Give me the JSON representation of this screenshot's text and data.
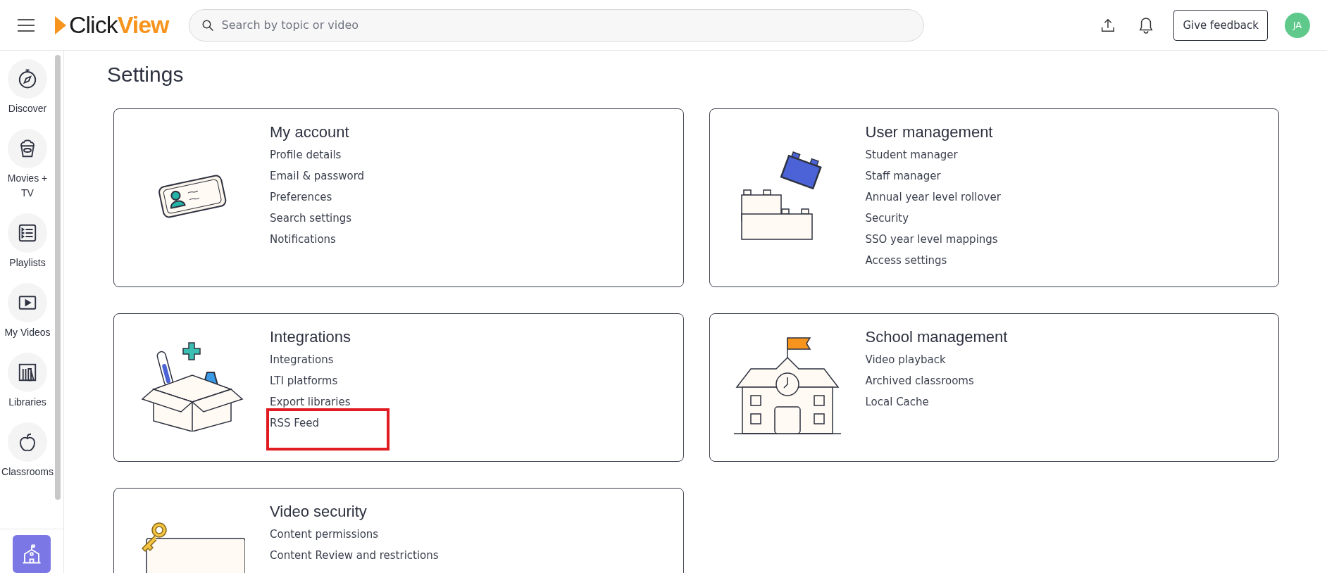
{
  "header": {
    "logo": {
      "first": "Click",
      "second": "View"
    },
    "search": {
      "placeholder": "Search by topic or video"
    },
    "feedback_button": "Give feedback",
    "avatar": {
      "initials": "JA",
      "color": "#5ec98a"
    }
  },
  "sidebar": {
    "items": [
      {
        "label": "Discover"
      },
      {
        "label": "Movies + TV"
      },
      {
        "label": "Playlists"
      },
      {
        "label": "My Videos"
      },
      {
        "label": "Libraries"
      },
      {
        "label": "Classrooms"
      }
    ]
  },
  "page": {
    "title": "Settings"
  },
  "cards": [
    {
      "title": "My account",
      "links": [
        {
          "label": "Profile details",
          "highlighted": false
        },
        {
          "label": "Email & password",
          "highlighted": false
        },
        {
          "label": "Preferences",
          "highlighted": false
        },
        {
          "label": "Search settings",
          "highlighted": false
        },
        {
          "label": "Notifications",
          "highlighted": false
        }
      ]
    },
    {
      "title": "User management",
      "links": [
        {
          "label": "Student manager",
          "highlighted": false
        },
        {
          "label": "Staff manager",
          "highlighted": false
        },
        {
          "label": "Annual year level rollover",
          "highlighted": false
        },
        {
          "label": "Security",
          "highlighted": false
        },
        {
          "label": "SSO year level mappings",
          "highlighted": false
        },
        {
          "label": "Access settings",
          "highlighted": false
        }
      ]
    },
    {
      "title": "Integrations",
      "links": [
        {
          "label": "Integrations",
          "highlighted": false
        },
        {
          "label": "LTI platforms",
          "highlighted": false
        },
        {
          "label": "Export libraries",
          "highlighted": false
        },
        {
          "label": "RSS Feed",
          "highlighted": true
        }
      ]
    },
    {
      "title": "School management",
      "links": [
        {
          "label": "Video playback",
          "highlighted": false
        },
        {
          "label": "Archived classrooms",
          "highlighted": false
        },
        {
          "label": "Local Cache",
          "highlighted": false
        }
      ]
    },
    {
      "title": "Video security",
      "links": [
        {
          "label": "Content permissions",
          "highlighted": false
        },
        {
          "label": "Content Review and restrictions",
          "highlighted": false
        }
      ]
    }
  ]
}
